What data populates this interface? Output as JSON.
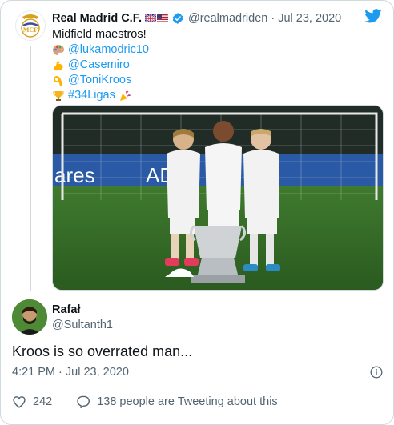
{
  "tweet": {
    "author_name": "Real Madrid C.F.",
    "author_flags": [
      "uk-flag",
      "us-flag"
    ],
    "author_handle": "@realmadriden",
    "separator": "·",
    "date": "Jul 23, 2020",
    "text_line_1": "Midfield maestros!",
    "mentions": [
      {
        "emoji": "palette",
        "text": "@lukamodric10"
      },
      {
        "emoji": "flexed-biceps",
        "text": "@Casemiro"
      },
      {
        "emoji": "ok-hand",
        "text": "@ToniKroos"
      },
      {
        "emoji": "trophy",
        "text": "#34Ligas",
        "trailing_emoji": "party-popper"
      }
    ],
    "photo": {
      "board_left": "ares",
      "board_right": "AD"
    }
  },
  "reply": {
    "author_name": "Rafał",
    "author_handle": "@Sultanth1",
    "text": "Kroos is so overrated man...",
    "time": "4:21 PM · Jul 23, 2020",
    "likes": "242",
    "conversation": "138 people are Tweeting about this"
  },
  "colors": {
    "link": "#1d9bf0",
    "like_icon": "#536471",
    "border": "#cfd9de"
  }
}
